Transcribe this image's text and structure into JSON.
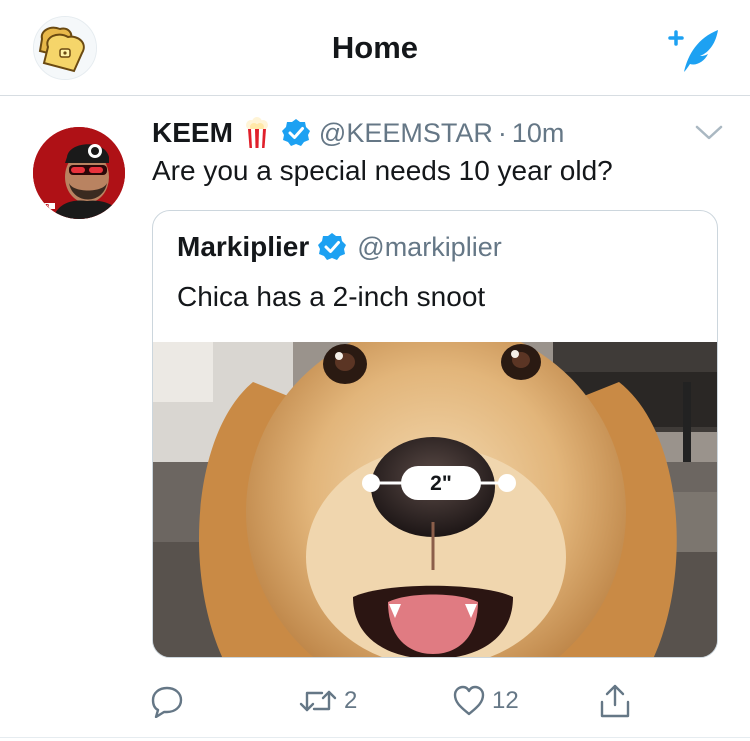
{
  "header": {
    "title": "Home",
    "profile_icon": "toast-icon",
    "compose_icon": "compose-tweet-icon",
    "accent": "#1da1f2"
  },
  "tweet": {
    "author_name": "KEEM",
    "author_emoji": "popcorn-icon",
    "verified": true,
    "handle": "@KEEMSTAR",
    "separator": "·",
    "time": "10m",
    "text": "Are you a special needs 10 year old?",
    "menu_icon": "chevron-down-icon",
    "quoted": {
      "author_name": "Markiplier",
      "verified": true,
      "handle": "@markiplier",
      "text": "Chica has a 2-inch snoot",
      "image_label": "2\""
    },
    "actions": {
      "reply_icon": "reply-icon",
      "retweet_icon": "retweet-icon",
      "retweet_count": "2",
      "like_icon": "heart-icon",
      "like_count": "12",
      "share_icon": "share-icon"
    }
  },
  "colors": {
    "text_primary": "#14171a",
    "text_secondary": "#657786",
    "verified_blue": "#1da1f2",
    "border": "#ccd6dd"
  }
}
